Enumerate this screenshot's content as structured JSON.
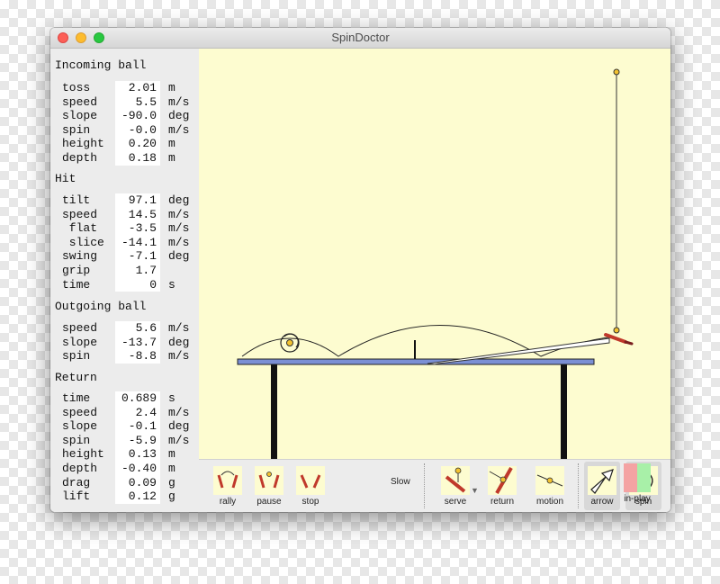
{
  "window": {
    "title": "SpinDoctor"
  },
  "panel": {
    "incoming": {
      "title": "Incoming ball",
      "rows": [
        {
          "label": "toss",
          "value": "2.01",
          "unit": "m"
        },
        {
          "label": "speed",
          "value": "5.5",
          "unit": "m/s"
        },
        {
          "label": "slope",
          "value": "-90.0",
          "unit": "deg"
        },
        {
          "label": "spin",
          "value": "-0.0",
          "unit": "m/s"
        },
        {
          "label": "height",
          "value": "0.20",
          "unit": "m"
        },
        {
          "label": "depth",
          "value": "0.18",
          "unit": "m"
        }
      ]
    },
    "hit": {
      "title": "Hit",
      "rows": [
        {
          "label": "tilt",
          "value": "97.1",
          "unit": "deg"
        },
        {
          "label": "speed",
          "value": "14.5",
          "unit": "m/s"
        },
        {
          "label": " flat",
          "value": "-3.5",
          "unit": "m/s"
        },
        {
          "label": " slice",
          "value": "-14.1",
          "unit": "m/s"
        },
        {
          "label": "swing",
          "value": "-7.1",
          "unit": "deg"
        },
        {
          "label": "grip",
          "value": "1.7",
          "unit": ""
        },
        {
          "label": "time",
          "value": "0",
          "unit": "s"
        }
      ]
    },
    "outgoing": {
      "title": "Outgoing ball",
      "rows": [
        {
          "label": "speed",
          "value": "5.6",
          "unit": "m/s"
        },
        {
          "label": "slope",
          "value": "-13.7",
          "unit": "deg"
        },
        {
          "label": "spin",
          "value": "-8.8",
          "unit": "m/s"
        }
      ]
    },
    "return": {
      "title": "Return",
      "rows": [
        {
          "label": "time",
          "value": "0.689",
          "unit": "s"
        },
        {
          "label": "speed",
          "value": "2.4",
          "unit": "m/s"
        },
        {
          "label": "slope",
          "value": "-0.1",
          "unit": "deg"
        },
        {
          "label": "spin",
          "value": "-5.9",
          "unit": "m/s"
        },
        {
          "label": "height",
          "value": "0.13",
          "unit": "m"
        },
        {
          "label": "depth",
          "value": "-0.40",
          "unit": "m"
        },
        {
          "label": "drag",
          "value": "0.09",
          "unit": "g"
        },
        {
          "label": "lift",
          "value": "0.12",
          "unit": "g"
        }
      ]
    }
  },
  "toolbar": {
    "rally": "rally",
    "pause": "pause",
    "stop": "stop",
    "slow": "Slow",
    "serve": "serve",
    "return": "return",
    "motion": "motion",
    "arrow": "arrow",
    "spin": "spin",
    "inplay": "in-play"
  },
  "colors": {
    "canvas": "#fdfcd0",
    "table_top": "#7b8fd4",
    "table_legs": "#111111",
    "paddle": "#c0392b",
    "ball": "#f2c230",
    "inplay_red": "#f4a3a3",
    "inplay_green": "#a8f0a8"
  }
}
